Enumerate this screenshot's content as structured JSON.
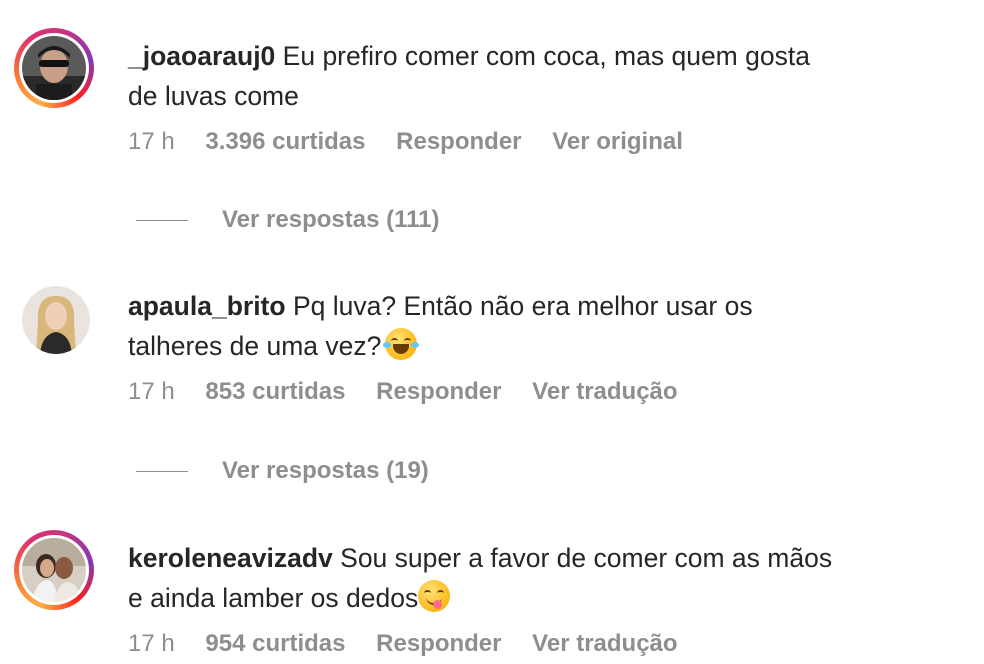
{
  "comments": [
    {
      "username": "_joaoarauj0",
      "text_line1": "Eu prefiro comer com coca, mas quem gosta",
      "text_line2": "de luvas come",
      "time": "17 h",
      "likes": "3.396 curtidas",
      "reply_label": "Responder",
      "translate_label": "Ver original",
      "view_replies": "Ver respostas (111)",
      "has_story_ring": true
    },
    {
      "username": "apaula_brito",
      "text_line1": "Pq luva? Então não era melhor usar os",
      "text_line2": "talheres de uma vez?",
      "emoji": "face-with-tears-of-joy",
      "time": "17 h",
      "likes": "853 curtidas",
      "reply_label": "Responder",
      "translate_label": "Ver tradução",
      "view_replies": "Ver respostas (19)",
      "has_story_ring": false
    },
    {
      "username": "keroleneavizadv",
      "text_line1": "Sou super a favor de comer com as mãos",
      "text_line2": "e ainda lamber os dedos",
      "emoji": "face-savoring-food",
      "time": "17 h",
      "likes": "954 curtidas",
      "reply_label": "Responder",
      "translate_label": "Ver tradução",
      "has_story_ring": true
    }
  ],
  "colors": {
    "text": "#262626",
    "secondary": "#8e8e8e",
    "story_ring": [
      "#fcaf45",
      "#e1306c",
      "#833ab4"
    ]
  }
}
